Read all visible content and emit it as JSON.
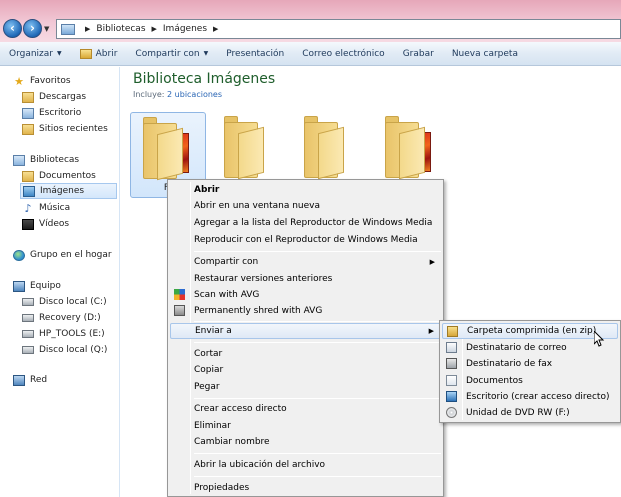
{
  "address": {
    "crumbs": [
      "Bibliotecas",
      "Imágenes"
    ]
  },
  "toolbar": {
    "organize": "Organizar",
    "open": "Abrir",
    "share": "Compartir con",
    "slideshow": "Presentación",
    "email": "Correo electrónico",
    "burn": "Grabar",
    "new_folder": "Nueva carpeta"
  },
  "sidebar": {
    "favorites": "Favoritos",
    "downloads": "Descargas",
    "desktop": "Escritorio",
    "recent": "Sitios recientes",
    "libraries": "Bibliotecas",
    "documents": "Documentos",
    "images": "Imágenes",
    "music": "Música",
    "videos": "Vídeos",
    "homegroup": "Grupo en el hogar",
    "computer": "Equipo",
    "drive_c": "Disco local (C:)",
    "drive_d": "Recovery (D:)",
    "drive_e": "HP_TOOLS (E:)",
    "drive_q": "Disco local (Q:)",
    "network": "Red"
  },
  "main": {
    "title": "Biblioteca Imágenes",
    "includes_label": "Incluye:",
    "includes_link": "2 ubicaciones",
    "first_folder_label": "Fo"
  },
  "context_menu": {
    "open": "Abrir",
    "open_new_window": "Abrir en una ventana nueva",
    "add_wmp_list": "Agregar a la lista del Reproductor de Windows Media",
    "play_wmp": "Reproducir con el Reproductor de Windows Media",
    "share_with": "Compartir con",
    "restore_versions": "Restaurar versiones anteriores",
    "scan_avg": "Scan with AVG",
    "shred_avg": "Permanently shred with AVG",
    "send_to": "Enviar a",
    "cut": "Cortar",
    "copy": "Copiar",
    "paste": "Pegar",
    "create_shortcut": "Crear acceso directo",
    "delete": "Eliminar",
    "rename": "Cambiar nombre",
    "open_location": "Abrir la ubicación del archivo",
    "properties": "Propiedades"
  },
  "send_to_menu": {
    "zip": "Carpeta comprimida (en zip)",
    "mail": "Destinatario de correo",
    "fax": "Destinatario de fax",
    "documents": "Documentos",
    "desktop": "Escritorio (crear acceso directo)",
    "dvd": "Unidad de DVD RW (F:)"
  }
}
